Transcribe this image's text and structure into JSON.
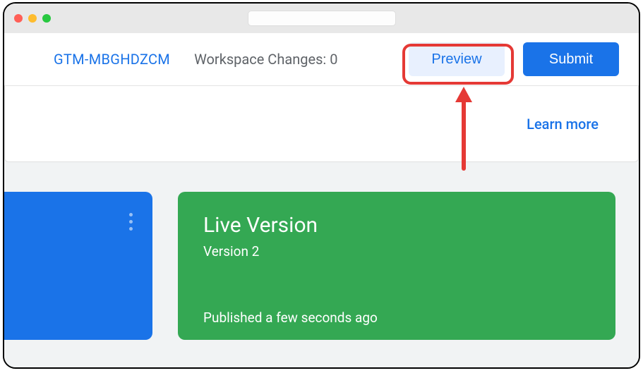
{
  "header": {
    "containerId": "GTM-MBGHDZCM",
    "workspaceChangesLabel": "Workspace Changes:",
    "workspaceChangesCount": "0",
    "previewLabel": "Preview",
    "submitLabel": "Submit"
  },
  "infoCard": {
    "learnMore": "Learn more"
  },
  "liveVersion": {
    "title": "Live Version",
    "subtitle": "Version 2",
    "published": "Published a few seconds ago"
  }
}
